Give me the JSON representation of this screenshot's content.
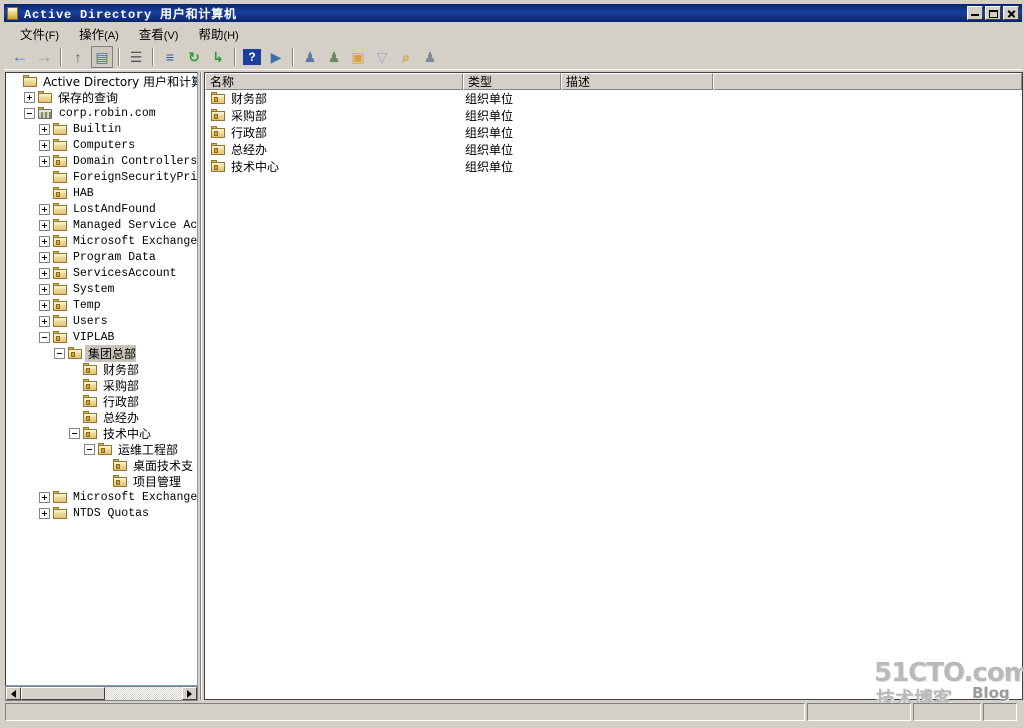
{
  "window": {
    "title": "Active Directory 用户和计算机",
    "icon": "folder-icon",
    "minimize_label": "最小化",
    "maximize_label": "最大化",
    "close_label": "关闭"
  },
  "menu": {
    "items": [
      {
        "label": "文件",
        "mnemonic": "(F)"
      },
      {
        "label": "操作",
        "mnemonic": "(A)"
      },
      {
        "label": "查看",
        "mnemonic": "(V)"
      },
      {
        "label": "帮助",
        "mnemonic": "(H)"
      }
    ]
  },
  "toolbar": {
    "buttons": [
      {
        "name": "back-icon",
        "glyph": "←",
        "color": "#4a78c8",
        "pressed": false
      },
      {
        "name": "forward-icon",
        "glyph": "→",
        "color": "#9a9a9a",
        "pressed": false
      },
      {
        "name": "separator-1",
        "glyph": "",
        "color": "",
        "pressed": false
      },
      {
        "name": "up-one-level-icon",
        "glyph": "↑",
        "color": "#2f7a2f",
        "pressed": false
      },
      {
        "name": "show-hide-console-tree-icon",
        "glyph": "▤",
        "color": "#4a6fa5",
        "pressed": true
      },
      {
        "name": "separator-2",
        "glyph": "",
        "color": "",
        "pressed": false
      },
      {
        "name": "properties-icon",
        "glyph": "☰",
        "color": "#555555",
        "pressed": false
      },
      {
        "name": "separator-3",
        "glyph": "",
        "color": "",
        "pressed": false
      },
      {
        "name": "export-list-icon",
        "glyph": "≡",
        "color": "#2a5ca8",
        "pressed": false
      },
      {
        "name": "refresh-icon",
        "glyph": "↻",
        "color": "#2f9a2f",
        "pressed": false
      },
      {
        "name": "new-item-icon",
        "glyph": "↳",
        "color": "#2f9a2f",
        "pressed": false
      },
      {
        "name": "separator-4",
        "glyph": "",
        "color": "",
        "pressed": false
      },
      {
        "name": "help-icon",
        "glyph": "?",
        "color": "#ffffff",
        "pressed": false
      },
      {
        "name": "console-window-icon",
        "glyph": "▶",
        "color": "#3f6fa8",
        "pressed": false
      },
      {
        "name": "separator-5",
        "glyph": "",
        "color": "",
        "pressed": false
      },
      {
        "name": "new-user-icon",
        "glyph": "♟",
        "color": "#5a7aa8",
        "pressed": false
      },
      {
        "name": "new-group-icon",
        "glyph": "♟",
        "color": "#6a8a5a",
        "pressed": false
      },
      {
        "name": "new-organizational-unit-icon",
        "glyph": "▣",
        "color": "#d8a13a",
        "pressed": false
      },
      {
        "name": "filter-icon",
        "glyph": "▽",
        "color": "#9aa8c4",
        "pressed": false
      },
      {
        "name": "find-icon",
        "glyph": "⌕",
        "color": "#c8a23a",
        "pressed": false
      },
      {
        "name": "find-users-icon",
        "glyph": "♟",
        "color": "#7a8a9a",
        "pressed": false
      }
    ]
  },
  "tree": {
    "root_label": "Active Directory 用户和计算机",
    "nodes": [
      {
        "label": "Active Directory 用户和计算机",
        "depth": 0,
        "expander": "none",
        "icon": "folder-icon",
        "cjk": true,
        "selected": false
      },
      {
        "label": "保存的查询",
        "depth": 1,
        "expander": "plus",
        "icon": "folder-icon",
        "cjk": true,
        "selected": false
      },
      {
        "label": "corp.robin.com",
        "depth": 1,
        "expander": "minus",
        "icon": "domain-icon",
        "cjk": false,
        "selected": false
      },
      {
        "label": "Builtin",
        "depth": 2,
        "expander": "plus",
        "icon": "folder-icon",
        "cjk": false,
        "selected": false
      },
      {
        "label": "Computers",
        "depth": 2,
        "expander": "plus",
        "icon": "folder-icon",
        "cjk": false,
        "selected": false
      },
      {
        "label": "Domain Controllers",
        "depth": 2,
        "expander": "plus",
        "icon": "ou-icon",
        "cjk": false,
        "selected": false
      },
      {
        "label": "ForeignSecurityPrincip",
        "depth": 2,
        "expander": "none",
        "icon": "folder-icon",
        "cjk": false,
        "selected": false
      },
      {
        "label": "HAB",
        "depth": 2,
        "expander": "none",
        "icon": "ou-icon",
        "cjk": false,
        "selected": false
      },
      {
        "label": "LostAndFound",
        "depth": 2,
        "expander": "plus",
        "icon": "folder-icon",
        "cjk": false,
        "selected": false
      },
      {
        "label": "Managed Service Accoun",
        "depth": 2,
        "expander": "plus",
        "icon": "folder-icon",
        "cjk": false,
        "selected": false
      },
      {
        "label": "Microsoft Exchange Sec",
        "depth": 2,
        "expander": "plus",
        "icon": "ou-icon",
        "cjk": false,
        "selected": false
      },
      {
        "label": "Program Data",
        "depth": 2,
        "expander": "plus",
        "icon": "folder-icon",
        "cjk": false,
        "selected": false
      },
      {
        "label": "ServicesAccount",
        "depth": 2,
        "expander": "plus",
        "icon": "ou-icon",
        "cjk": false,
        "selected": false
      },
      {
        "label": "System",
        "depth": 2,
        "expander": "plus",
        "icon": "folder-icon",
        "cjk": false,
        "selected": false
      },
      {
        "label": "Temp",
        "depth": 2,
        "expander": "plus",
        "icon": "ou-icon",
        "cjk": false,
        "selected": false
      },
      {
        "label": "Users",
        "depth": 2,
        "expander": "plus",
        "icon": "folder-icon",
        "cjk": false,
        "selected": false
      },
      {
        "label": "VIPLAB",
        "depth": 2,
        "expander": "minus",
        "icon": "ou-icon",
        "cjk": false,
        "selected": false
      },
      {
        "label": "集团总部",
        "depth": 3,
        "expander": "minus",
        "icon": "ou-icon",
        "cjk": true,
        "selected": true
      },
      {
        "label": "财务部",
        "depth": 4,
        "expander": "none",
        "icon": "ou-icon",
        "cjk": true,
        "selected": false
      },
      {
        "label": "采购部",
        "depth": 4,
        "expander": "none",
        "icon": "ou-icon",
        "cjk": true,
        "selected": false
      },
      {
        "label": "行政部",
        "depth": 4,
        "expander": "none",
        "icon": "ou-icon",
        "cjk": true,
        "selected": false
      },
      {
        "label": "总经办",
        "depth": 4,
        "expander": "none",
        "icon": "ou-icon",
        "cjk": true,
        "selected": false
      },
      {
        "label": "技术中心",
        "depth": 4,
        "expander": "minus",
        "icon": "ou-icon",
        "cjk": true,
        "selected": false
      },
      {
        "label": "运维工程部",
        "depth": 5,
        "expander": "minus",
        "icon": "ou-icon",
        "cjk": true,
        "selected": false
      },
      {
        "label": "桌面技术支",
        "depth": 6,
        "expander": "none",
        "icon": "ou-icon",
        "cjk": true,
        "selected": false
      },
      {
        "label": "项目管理",
        "depth": 6,
        "expander": "none",
        "icon": "ou-icon",
        "cjk": true,
        "selected": false
      },
      {
        "label": "Microsoft Exchange Sys",
        "depth": 2,
        "expander": "plus",
        "icon": "folder-icon",
        "cjk": false,
        "selected": false
      },
      {
        "label": "NTDS Quotas",
        "depth": 2,
        "expander": "plus",
        "icon": "folder-icon",
        "cjk": false,
        "selected": false
      }
    ],
    "hscroll": {
      "left_arrow": "◀",
      "right_arrow": "▶"
    }
  },
  "list": {
    "columns": [
      {
        "label": "名称",
        "name": "column-name"
      },
      {
        "label": "类型",
        "name": "column-type"
      },
      {
        "label": "描述",
        "name": "column-description"
      }
    ],
    "rows": [
      {
        "name": "财务部",
        "type": "组织单位",
        "description": "",
        "icon": "ou-icon"
      },
      {
        "name": "采购部",
        "type": "组织单位",
        "description": "",
        "icon": "ou-icon"
      },
      {
        "name": "行政部",
        "type": "组织单位",
        "description": "",
        "icon": "ou-icon"
      },
      {
        "name": "总经办",
        "type": "组织单位",
        "description": "",
        "icon": "ou-icon"
      },
      {
        "name": "技术中心",
        "type": "组织单位",
        "description": "",
        "icon": "ou-icon"
      }
    ]
  },
  "statusbar": {
    "message": "",
    "pane2": "",
    "pane3": "",
    "pane4": ""
  },
  "watermark": {
    "line1": "51CTO.com",
    "line2": "技术博客",
    "line3": "Blog"
  },
  "colors": {
    "titlebar": "#0a246a",
    "face": "#d4d0c8",
    "selection": "#c8c4bc",
    "folder": "#e3c477"
  }
}
